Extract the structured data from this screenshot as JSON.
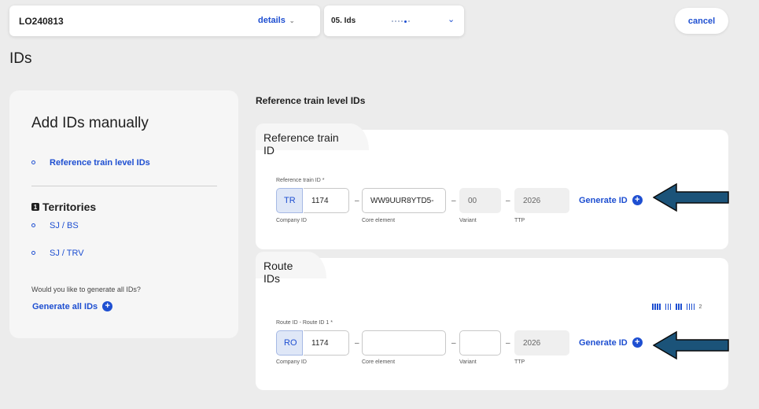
{
  "header": {
    "order_id": "LO240813",
    "details_label": "details",
    "step_label": "05. Ids",
    "cancel_label": "cancel"
  },
  "page_title": "IDs",
  "sidebar": {
    "title": "Add IDs manually",
    "primary_link": "Reference train level IDs",
    "section_number": "1",
    "section_title": "Territories",
    "territories": [
      "SJ / BS",
      "SJ / TRV"
    ],
    "question": "Would you like to generate all IDs?",
    "generate_all_label": "Generate all IDs"
  },
  "main": {
    "section_heading": "Reference train level IDs",
    "reference_train": {
      "tab_label": "Reference train ID",
      "field_label": "Reference train ID *",
      "prefix": "TR",
      "company_id": "1174",
      "core_element": "WW9UUR8YTD5-",
      "variant": "00",
      "ttp": "2026",
      "sub_labels": {
        "company": "Company ID",
        "core": "Core element",
        "variant": "Variant",
        "ttp": "TTP"
      },
      "generate_label": "Generate ID"
    },
    "route_ids": {
      "tab_label": "Route IDs",
      "field_label": "Route ID - Route ID 1 *",
      "prefix": "RO",
      "company_id": "1174",
      "core_element": "",
      "variant": "",
      "ttp": "2026",
      "sub_labels": {
        "company": "Company ID",
        "core": "Core element",
        "variant": "Variant",
        "ttp": "TTP"
      },
      "generate_label": "Generate ID",
      "count": "2"
    }
  },
  "colors": {
    "accent": "#1e4fd1",
    "arrow": "#1b5379"
  }
}
